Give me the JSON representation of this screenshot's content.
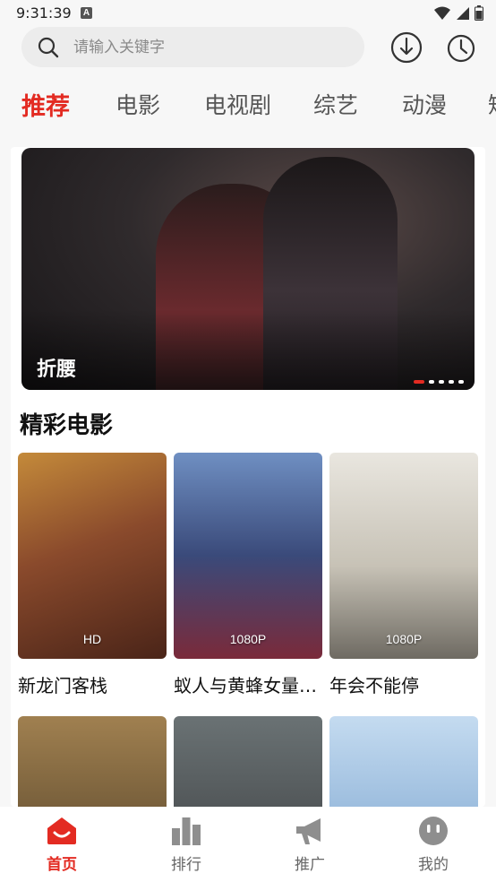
{
  "status": {
    "time": "9:31:39",
    "app_icon_letter": "A"
  },
  "search": {
    "placeholder": "请输入关键字",
    "value": ""
  },
  "tabs": [
    {
      "label": "推荐",
      "active": true
    },
    {
      "label": "电影",
      "active": false
    },
    {
      "label": "电视剧",
      "active": false
    },
    {
      "label": "综艺",
      "active": false
    },
    {
      "label": "动漫",
      "active": false
    },
    {
      "label": "短",
      "active": false
    }
  ],
  "banner": {
    "title": "折腰",
    "slide_count": 5,
    "active_slide": 1
  },
  "section": {
    "title": "精彩电影"
  },
  "movies": [
    {
      "title": "新龙门客栈",
      "quality": "HD",
      "poster_color": "#8a4a2c"
    },
    {
      "title": "蚁人与黄蜂女量…",
      "quality": "1080P",
      "poster_color": "#3a4a7a"
    },
    {
      "title": "年会不能停",
      "quality": "1080P",
      "poster_color": "#c7c2b6"
    },
    {
      "title": "",
      "quality": "",
      "poster_color": "#6a5434"
    },
    {
      "title": "",
      "quality": "",
      "poster_color": "#4a4e50"
    },
    {
      "title": "",
      "quality": "",
      "poster_color": "#8fb3d8"
    }
  ],
  "bottom_nav": [
    {
      "label": "首页",
      "icon": "home-icon",
      "active": true
    },
    {
      "label": "排行",
      "icon": "bar-chart-icon",
      "active": false
    },
    {
      "label": "推广",
      "icon": "megaphone-icon",
      "active": false
    },
    {
      "label": "我的",
      "icon": "profile-face-icon",
      "active": false
    }
  ],
  "colors": {
    "accent": "#e32b22",
    "icon_gray": "#8e8e8e",
    "background": "#f7f7f7"
  }
}
